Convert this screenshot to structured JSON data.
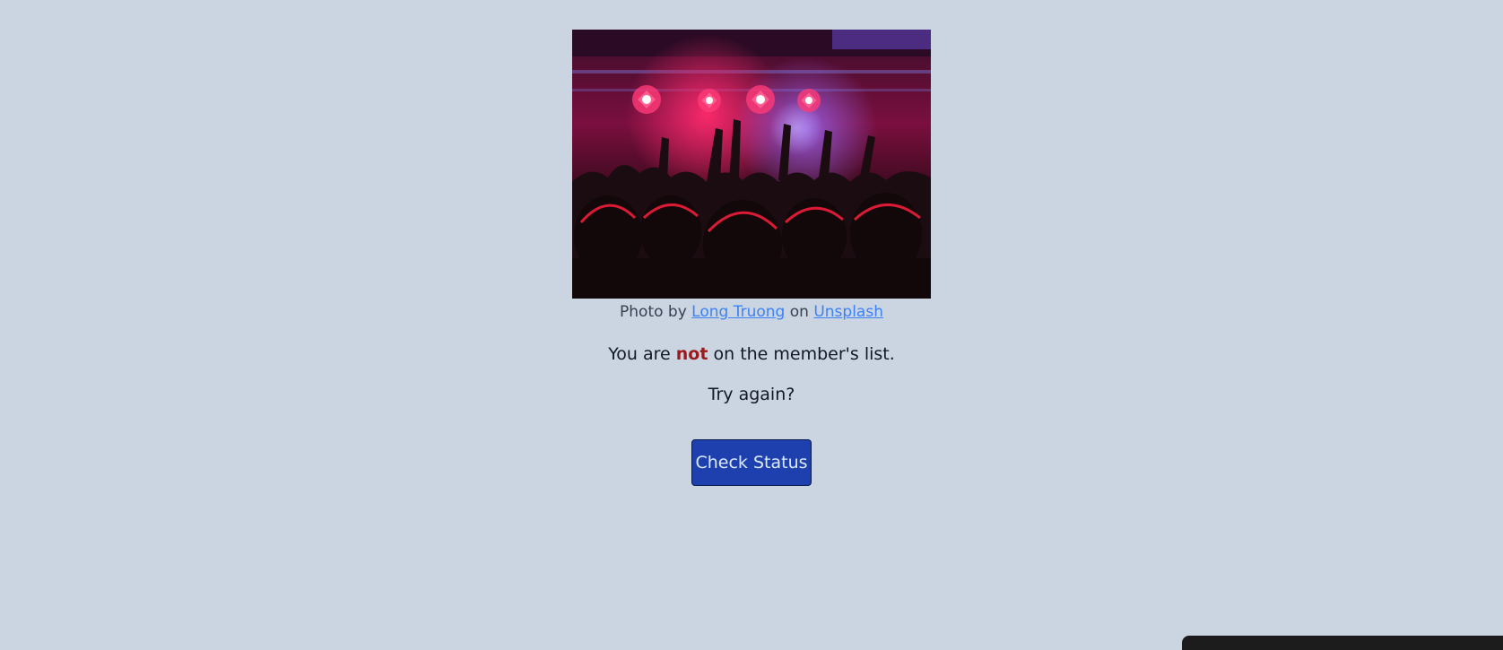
{
  "photo": {
    "alt": "Concert crowd with hands raised under red stage lights"
  },
  "credit": {
    "prefix": "Photo by",
    "author": "Long Truong",
    "middle": "on",
    "site": "Unsplash"
  },
  "message": {
    "before": "You are",
    "emphasis": "not",
    "after": "on the member's list."
  },
  "retry": "Try again?",
  "button": {
    "label": "Check Status"
  },
  "colors": {
    "background": "#cbd5e1",
    "link": "#3b82f6",
    "emphasis": "#991b1b",
    "button": "#1e40af",
    "button_text": "#dbeafe",
    "corner_panel": "#1c1c1c"
  }
}
